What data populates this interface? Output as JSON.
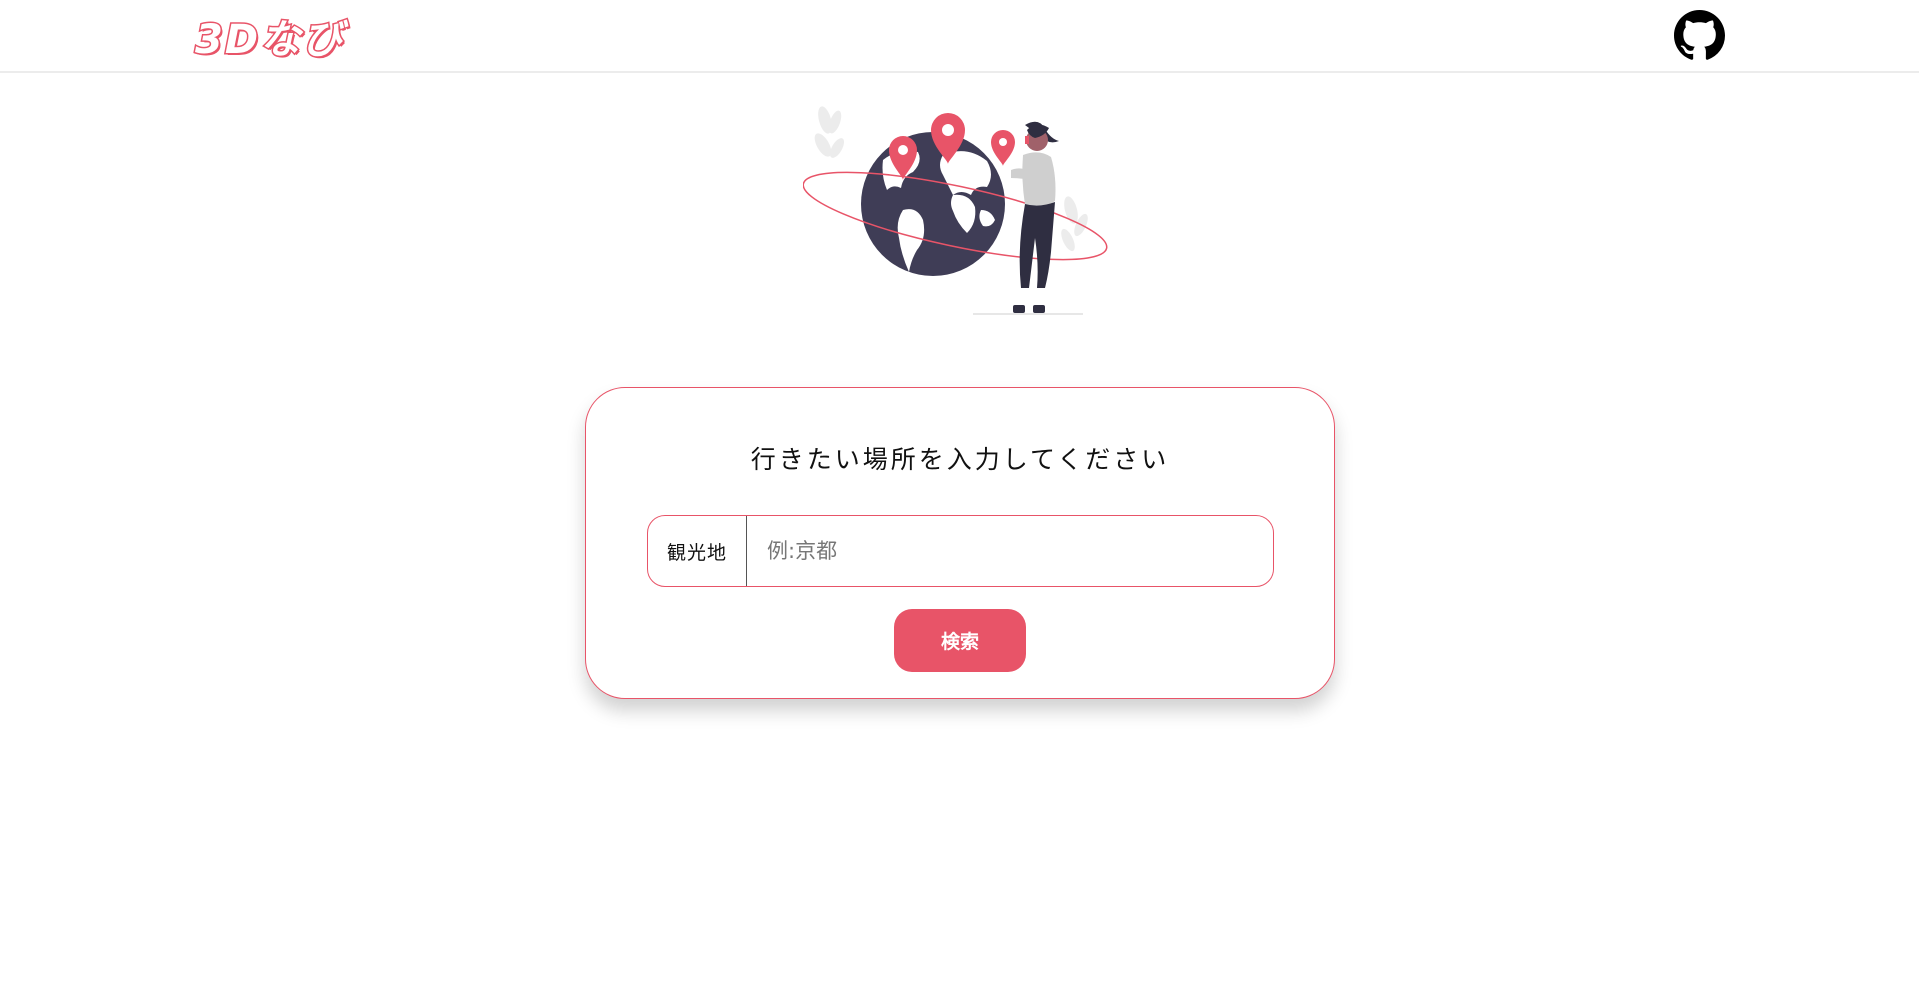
{
  "header": {
    "logo_text": "3Dなび",
    "github_icon": "github-icon"
  },
  "hero": {
    "illustration": "woman-with-globe-and-map-pins"
  },
  "search_card": {
    "title": "行きたい場所を入力してください",
    "input_label": "観光地",
    "input_placeholder": "例:京都",
    "input_value": "",
    "button_label": "検索"
  },
  "colors": {
    "accent": "#e85468",
    "dark": "#3f3d56",
    "border": "#ececec"
  }
}
